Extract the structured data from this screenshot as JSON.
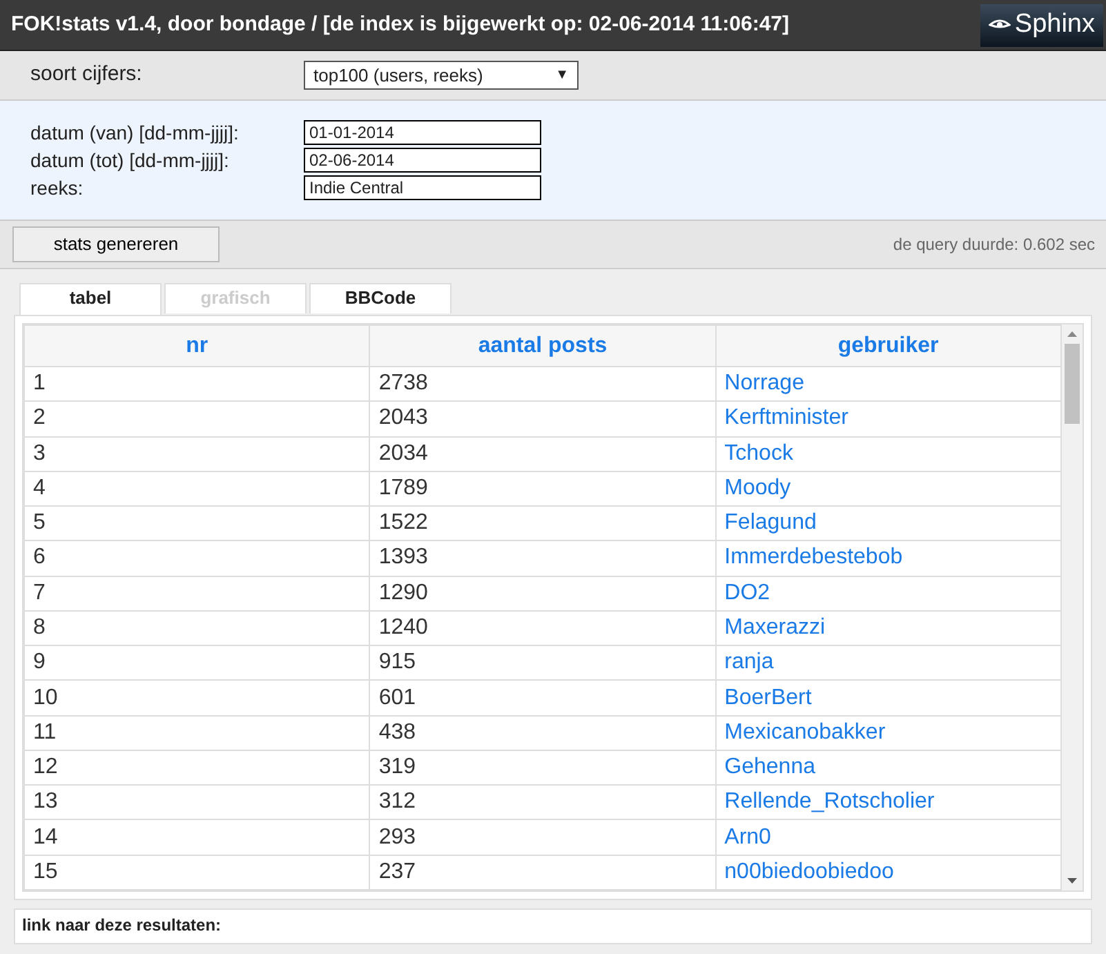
{
  "header": {
    "title": "FOK!stats v1.4, door bondage / [de index is bijgewerkt op: 02-06-2014 11:06:47]",
    "logo": "Sphinx"
  },
  "type_select": {
    "label": "soort cijfers:",
    "value": "top100 (users, reeks)",
    "arrow": "▼"
  },
  "fields": [
    {
      "label": "datum (van) [dd-mm-jjjj]:",
      "value": "01-01-2014"
    },
    {
      "label": "datum (tot) [dd-mm-jjjj]:",
      "value": "02-06-2014"
    },
    {
      "label": "reeks:",
      "value": "Indie Central"
    }
  ],
  "generate_button": "stats genereren",
  "query_time": "de query duurde: 0.602 sec",
  "tabs": [
    {
      "label": "tabel",
      "selected": true,
      "disabled": false
    },
    {
      "label": "grafisch",
      "selected": false,
      "disabled": true
    },
    {
      "label": "BBCode",
      "selected": false,
      "disabled": false
    }
  ],
  "table": {
    "columns": [
      "nr",
      "aantal posts",
      "gebruiker"
    ],
    "rows": [
      [
        "1",
        "2738",
        "Norrage"
      ],
      [
        "2",
        "2043",
        "Kerftminister"
      ],
      [
        "3",
        "2034",
        "Tchock"
      ],
      [
        "4",
        "1789",
        "Moody"
      ],
      [
        "5",
        "1522",
        "Felagund"
      ],
      [
        "6",
        "1393",
        "Immerdebestebob"
      ],
      [
        "7",
        "1290",
        "DO2"
      ],
      [
        "8",
        "1240",
        "Maxerazzi"
      ],
      [
        "9",
        "915",
        "ranja"
      ],
      [
        "10",
        "601",
        "BoerBert"
      ],
      [
        "11",
        "438",
        "Mexicanobakker"
      ],
      [
        "12",
        "319",
        "Gehenna"
      ],
      [
        "13",
        "312",
        "Rellende_Rotscholier"
      ],
      [
        "14",
        "293",
        "Arn0"
      ],
      [
        "15",
        "237",
        "n00biedoobiedoo"
      ]
    ]
  },
  "link_section": {
    "label": "link naar deze resultaten:"
  }
}
